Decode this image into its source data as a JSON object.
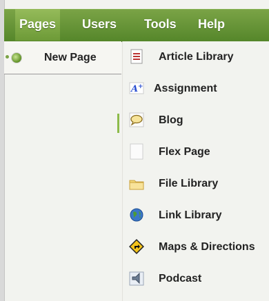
{
  "menubar": {
    "items": [
      {
        "label": "Pages",
        "active": true
      },
      {
        "label": "Users",
        "active": false
      },
      {
        "label": "Tools",
        "active": false
      },
      {
        "label": "Help",
        "active": false
      }
    ]
  },
  "new_page": {
    "label": "New Page",
    "icon": "green-dot-icon"
  },
  "submenu": {
    "items": [
      {
        "label": "Article Library",
        "icon": "article-library-icon"
      },
      {
        "label": "Assignment",
        "icon": "assignment-icon"
      },
      {
        "label": "Blog",
        "icon": "blog-icon"
      },
      {
        "label": "Flex Page",
        "icon": "flex-page-icon"
      },
      {
        "label": "File Library",
        "icon": "file-library-icon"
      },
      {
        "label": "Link Library",
        "icon": "link-library-icon"
      },
      {
        "label": "Maps & Directions",
        "icon": "maps-directions-icon"
      },
      {
        "label": "Podcast",
        "icon": "podcast-icon"
      }
    ]
  },
  "colors": {
    "menubar": "#5f8f31",
    "active_tab": "#86ad4b",
    "background": "#f2f3ef"
  }
}
